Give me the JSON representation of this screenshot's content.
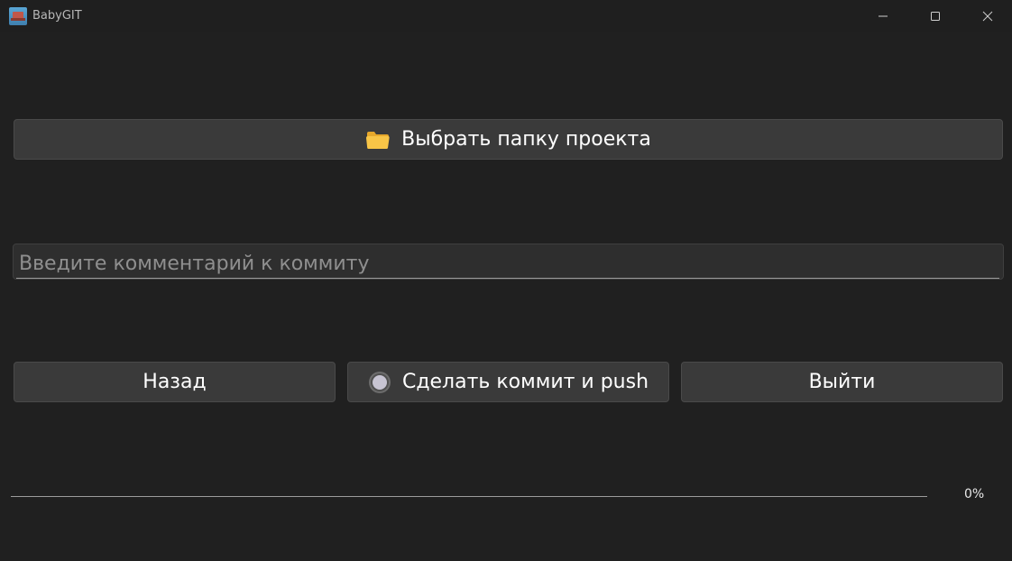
{
  "window": {
    "title": "BabyGIT"
  },
  "buttons": {
    "select_folder": {
      "label": "Выбрать папку проекта",
      "icon": "folder-icon"
    },
    "back": {
      "label": "Назад"
    },
    "commit_push": {
      "label": "Сделать коммит и push",
      "icon": "radio-circle-icon"
    },
    "exit": {
      "label": "Выйти"
    }
  },
  "commit_input": {
    "placeholder": "Введите комментарий к коммиту",
    "value": ""
  },
  "progress": {
    "value": 0,
    "label": "0%"
  },
  "colors": {
    "background": "#202020",
    "button": "#3a3a3a",
    "text": "#ffffff",
    "folder": "#f5c24a"
  }
}
